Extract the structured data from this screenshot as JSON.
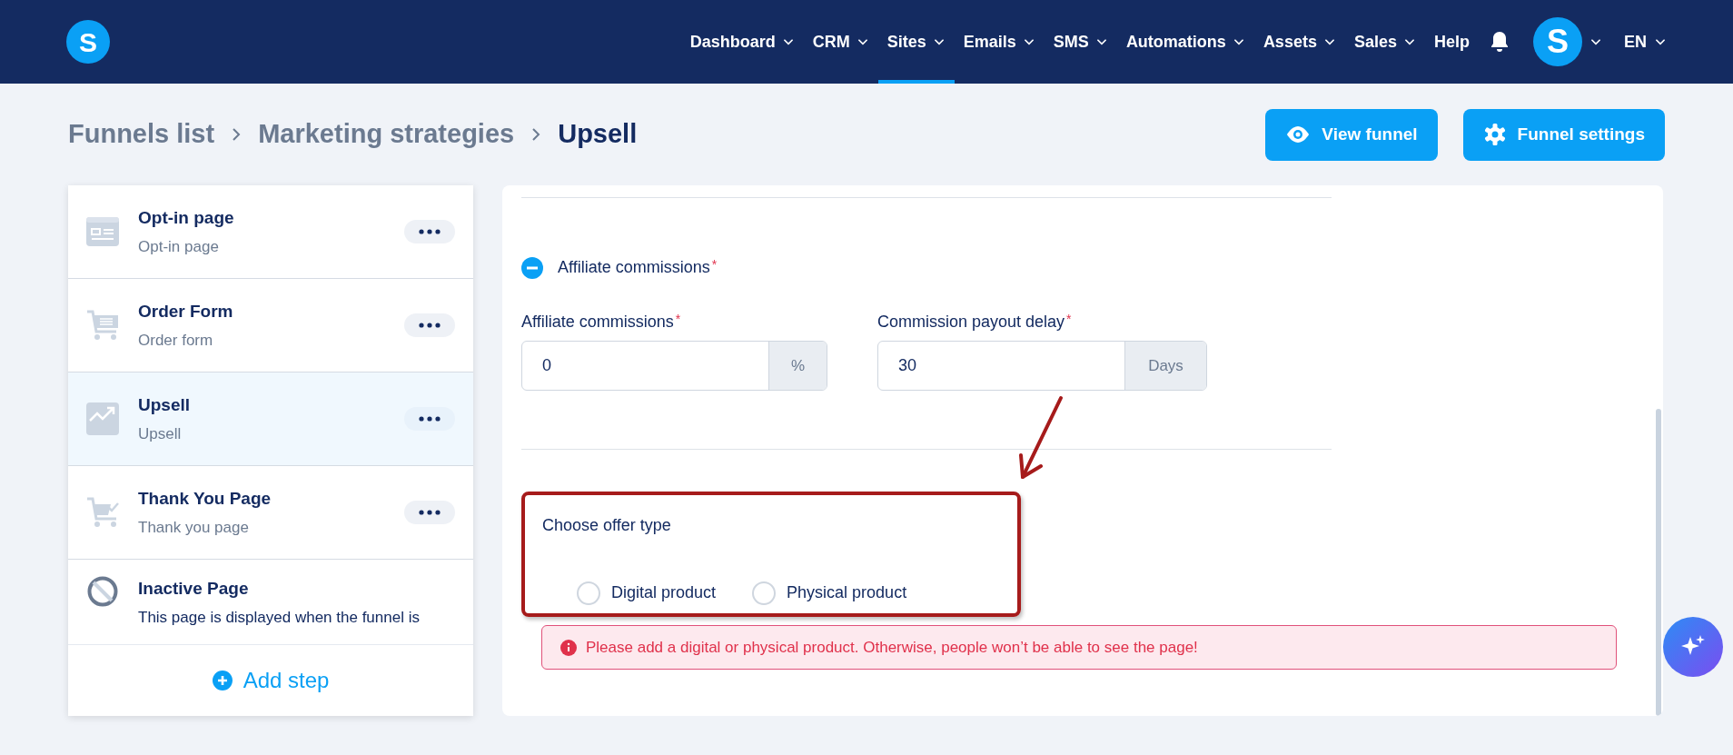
{
  "header": {
    "logo_letter": "S",
    "nav": [
      {
        "label": "Dashboard",
        "dropdown": true,
        "selected": false
      },
      {
        "label": "CRM",
        "dropdown": true,
        "selected": false
      },
      {
        "label": "Sites",
        "dropdown": true,
        "selected": true
      },
      {
        "label": "Emails",
        "dropdown": true,
        "selected": false
      },
      {
        "label": "SMS",
        "dropdown": true,
        "selected": false
      },
      {
        "label": "Automations",
        "dropdown": true,
        "selected": false
      },
      {
        "label": "Assets",
        "dropdown": true,
        "selected": false
      },
      {
        "label": "Sales",
        "dropdown": true,
        "selected": false
      },
      {
        "label": "Help",
        "dropdown": false,
        "selected": false
      }
    ],
    "avatar_letter": "S",
    "language": "EN"
  },
  "breadcrumb": [
    {
      "label": "Funnels list",
      "current": false
    },
    {
      "label": "Marketing strategies",
      "current": false
    },
    {
      "label": "Upsell",
      "current": true
    }
  ],
  "actions": [
    {
      "label": "View funnel",
      "kind": "view"
    },
    {
      "label": "Funnel settings",
      "kind": "settings"
    }
  ],
  "steps": [
    {
      "kind": "optin",
      "title": "Opt-in page",
      "subtitle": "Opt-in page",
      "selected": false
    },
    {
      "kind": "order",
      "title": "Order Form",
      "subtitle": "Order form",
      "selected": false
    },
    {
      "kind": "upsell",
      "title": "Upsell",
      "subtitle": "Upsell",
      "selected": true
    },
    {
      "kind": "thankyou",
      "title": "Thank You Page",
      "subtitle": "Thank you page",
      "selected": false
    },
    {
      "kind": "inactive",
      "title": "Inactive Page",
      "subtitle": "This page is displayed when the funnel is",
      "selected": false
    }
  ],
  "add_step": "Add step",
  "form": {
    "section": {
      "label": "Affiliate commissions",
      "required_mark": "*",
      "expanded": true
    },
    "fields": [
      {
        "label": "Affiliate commissions",
        "required_mark": "*",
        "value": "0",
        "addon": "%"
      },
      {
        "label": "Commission payout delay",
        "required_mark": "*",
        "value": "30",
        "addon": "Days"
      }
    ],
    "offer_type": {
      "label": "Choose offer type",
      "options": [
        {
          "label": "Digital product",
          "selected": false
        },
        {
          "label": "Physical product",
          "selected": false
        }
      ]
    },
    "alert": "Please add a digital or physical product. Otherwise, people won’t be able to see the page!"
  }
}
